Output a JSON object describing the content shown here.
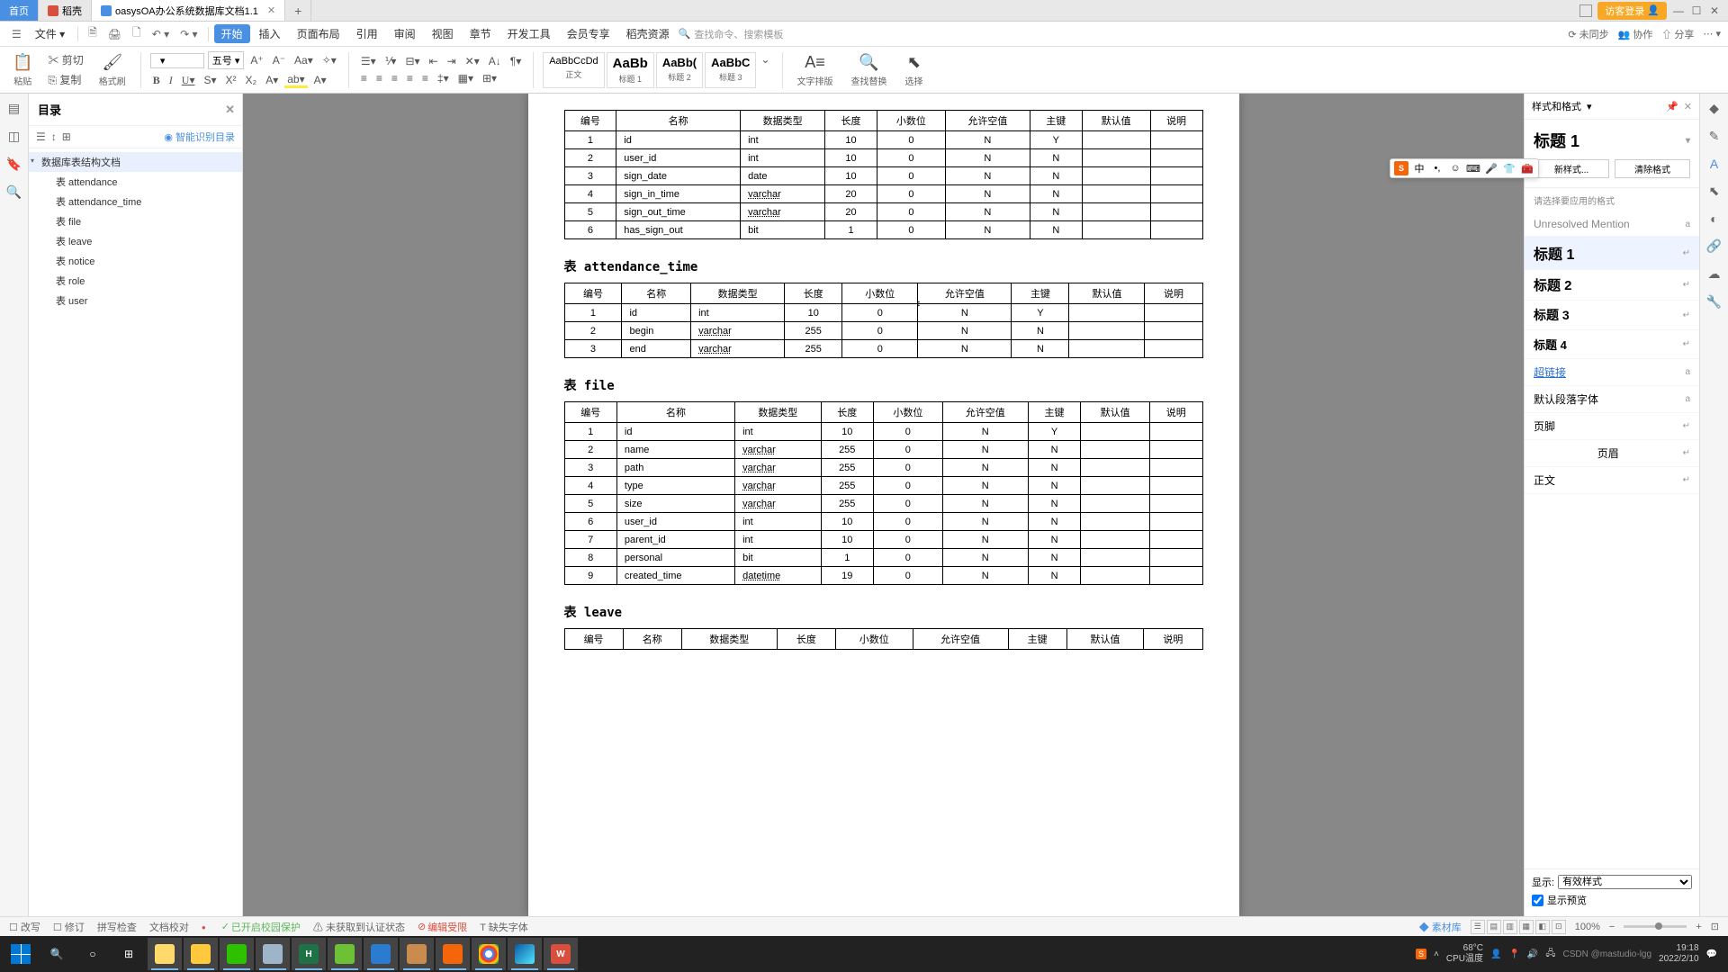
{
  "titlebar": {
    "tabs": [
      {
        "label": "首页",
        "type": "home"
      },
      {
        "label": "稻壳",
        "type": "doc"
      },
      {
        "label": "oasysOA办公系统数据库文档1.1",
        "type": "active"
      }
    ],
    "login": "访客登录",
    "win": {
      "min": "—",
      "max": "☐",
      "close": "✕"
    }
  },
  "menubar": {
    "file": "文件",
    "items": [
      "开始",
      "插入",
      "页面布局",
      "引用",
      "审阅",
      "视图",
      "章节",
      "开发工具",
      "会员专享",
      "稻壳资源"
    ],
    "search_hint": "查找命令、搜索模板",
    "right": {
      "nosync": "未同步",
      "collab": "协作",
      "share": "分享"
    }
  },
  "ribbon": {
    "paste": "粘贴",
    "cut": "剪切",
    "copy": "复制",
    "fmtbrush": "格式刷",
    "font_size": "五号",
    "styles": [
      {
        "sample": "AaBbCcDd",
        "name": "正文"
      },
      {
        "sample": "AaBb",
        "name": "标题 1"
      },
      {
        "sample": "AaBb(",
        "name": "标题 2"
      },
      {
        "sample": "AaBbC",
        "name": "标题 3"
      }
    ],
    "text_layout": "文字排版",
    "find_replace": "查找替换",
    "select": "选择"
  },
  "outline": {
    "title": "目录",
    "smart": "智能识别目录",
    "root": "数据库表结构文档",
    "items": [
      "表 attendance",
      "表 attendance_time",
      "表 file",
      "表 leave",
      "表 notice",
      "表 role",
      "表 user"
    ]
  },
  "doc": {
    "table_headers": [
      "编号",
      "名称",
      "数据类型",
      "长度",
      "小数位",
      "允许空值",
      "主键",
      "默认值",
      "说明"
    ],
    "table1_rows": [
      [
        "1",
        "id",
        "int",
        "10",
        "0",
        "N",
        "Y",
        "",
        ""
      ],
      [
        "2",
        "user_id",
        "int",
        "10",
        "0",
        "N",
        "N",
        "",
        ""
      ],
      [
        "3",
        "sign_date",
        "date",
        "10",
        "0",
        "N",
        "N",
        "",
        ""
      ],
      [
        "4",
        "sign_in_time",
        "varchar",
        "20",
        "0",
        "N",
        "N",
        "",
        ""
      ],
      [
        "5",
        "sign_out_time",
        "varchar",
        "20",
        "0",
        "N",
        "N",
        "",
        ""
      ],
      [
        "6",
        "has_sign_out",
        "bit",
        "1",
        "0",
        "N",
        "N",
        "",
        ""
      ]
    ],
    "heading2": "表 attendance_time",
    "table2_rows": [
      [
        "1",
        "id",
        "int",
        "10",
        "0",
        "N",
        "Y",
        "",
        ""
      ],
      [
        "2",
        "begin",
        "varchar",
        "255",
        "0",
        "N",
        "N",
        "",
        ""
      ],
      [
        "3",
        "end",
        "varchar",
        "255",
        "0",
        "N",
        "N",
        "",
        ""
      ]
    ],
    "heading3": "表 file",
    "table3_rows": [
      [
        "1",
        "id",
        "int",
        "10",
        "0",
        "N",
        "Y",
        "",
        ""
      ],
      [
        "2",
        "name",
        "varchar",
        "255",
        "0",
        "N",
        "N",
        "",
        ""
      ],
      [
        "3",
        "path",
        "varchar",
        "255",
        "0",
        "N",
        "N",
        "",
        ""
      ],
      [
        "4",
        "type",
        "varchar",
        "255",
        "0",
        "N",
        "N",
        "",
        ""
      ],
      [
        "5",
        "size",
        "varchar",
        "255",
        "0",
        "N",
        "N",
        "",
        ""
      ],
      [
        "6",
        "user_id",
        "int",
        "10",
        "0",
        "N",
        "N",
        "",
        ""
      ],
      [
        "7",
        "parent_id",
        "int",
        "10",
        "0",
        "N",
        "N",
        "",
        ""
      ],
      [
        "8",
        "personal",
        "bit",
        "1",
        "0",
        "N",
        "N",
        "",
        ""
      ],
      [
        "9",
        "created_time",
        "datetime",
        "19",
        "0",
        "N",
        "N",
        "",
        ""
      ]
    ],
    "heading4": "表 leave"
  },
  "styles_panel": {
    "title": "样式和格式",
    "current": "标题 1",
    "new_style": "新样式...",
    "clear_fmt": "清除格式",
    "hint": "请选择要应用的格式",
    "unresolved": "Unresolved Mention",
    "list": [
      "标题 1",
      "标题 2",
      "标题 3",
      "标题 4"
    ],
    "hyperlink": "超链接",
    "default_font": "默认段落字体",
    "footer": "页脚",
    "header": "页眉",
    "body": "正文",
    "show_label": "显示:",
    "show_value": "有效样式",
    "preview": "显示预览"
  },
  "statusbar": {
    "accept": "改写",
    "revise": "修订",
    "spell": "拼写检查",
    "doccheck": "文档校对",
    "protection": "已开启校园保护",
    "cert": "未获取到认证状态",
    "editaccept": "编辑受限",
    "missing": "缺失字体",
    "material": "素材库",
    "zoom": "100%"
  },
  "taskbar": {
    "temp": "68°C",
    "cpu": "CPU温度",
    "time": "19:18",
    "date": "2022/2/10",
    "watermark": "CSDN @mastudio-lgg"
  }
}
